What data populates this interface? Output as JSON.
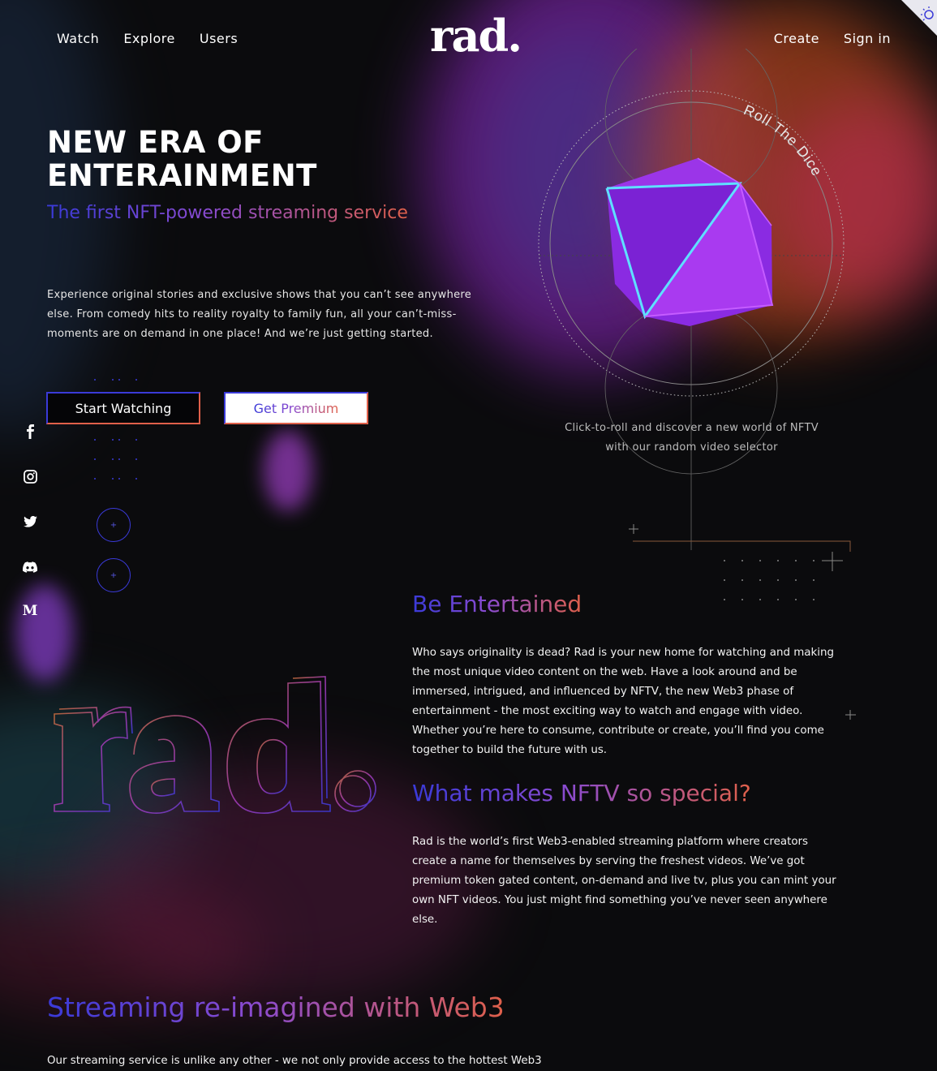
{
  "nav": {
    "left": [
      {
        "label": "Watch"
      },
      {
        "label": "Explore"
      },
      {
        "label": "Users"
      }
    ],
    "logo": "rad.",
    "right": [
      {
        "label": "Create"
      },
      {
        "label": "Sign in"
      }
    ]
  },
  "hero": {
    "title": "NEW ERA OF ENTERAINMENT",
    "subtitle": "The first NFT-powered streaming service",
    "description": "Experience original stories and exclusive shows that you can’t see anywhere else. From comedy hits to reality royalty to family fun, all your can’t-miss-moments are on demand in one place! And we’re just getting started.",
    "start_button": "Start Watching",
    "premium_button": "Get Premium"
  },
  "dice": {
    "ring_label": "Roll The Dice",
    "caption": "Click-to-roll and discover a new world of NFTV with our random video selector"
  },
  "social": [
    {
      "icon": "facebook-icon",
      "glyph": "f"
    },
    {
      "icon": "instagram-icon",
      "glyph": "◎"
    },
    {
      "icon": "twitter-icon",
      "glyph": "🐦"
    },
    {
      "icon": "discord-icon",
      "glyph": "◉"
    },
    {
      "icon": "medium-icon",
      "glyph": "M"
    }
  ],
  "sections": {
    "entertained_title": "Be Entertained",
    "entertained_text": "Who says originality is dead? Rad is your new home for watching and making the most unique video content on the web. Have a look around and be immersed, intrigued, and influenced by NFTV, the new Web3 phase of entertainment - the most exciting way to watch and engage with video. Whether you’re here to consume, contribute or create, you’ll find you come together to build the future with us.",
    "special_title": "What makes NFTV so special?",
    "special_text": "Rad is the world’s first Web3-enabled streaming platform where creators create a name for themselves by serving the freshest videos. We’ve got premium token gated content, on-demand and live tv, plus you can mint your own NFT videos. You just might find something you’ve never seen anywhere else.",
    "web3_title": "Streaming re-imagined with Web3",
    "web3_text": "Our streaming service is unlike any other - we not only provide access to the hottest Web3"
  },
  "colors": {
    "gradient_start": "#3a3ad8",
    "gradient_mid": "#8a4bd0",
    "gradient_end": "#e0604a",
    "background": "#0b0b0d"
  }
}
